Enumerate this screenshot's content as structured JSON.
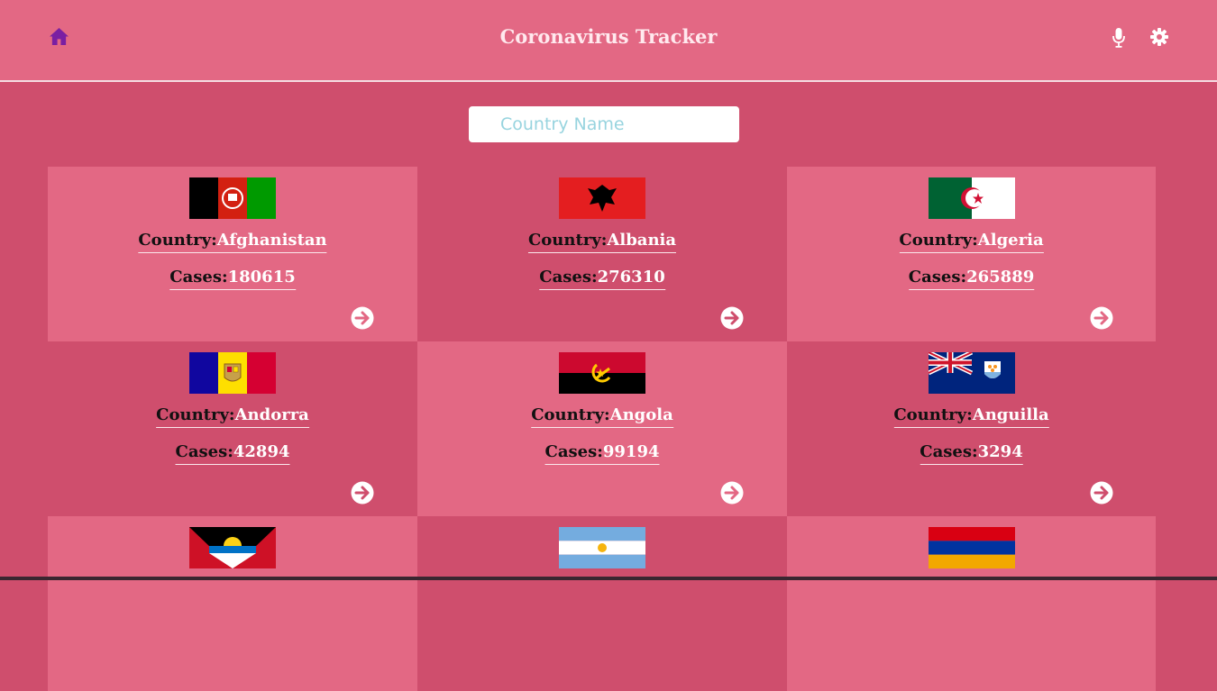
{
  "header": {
    "title": "Coronavirus Tracker",
    "home_icon": "home-icon",
    "mic_icon": "microphone-icon",
    "settings_icon": "gear-icon"
  },
  "search": {
    "placeholder": "Country Name",
    "value": ""
  },
  "labels": {
    "country": "Country:",
    "cases": "Cases:"
  },
  "colors": {
    "header_bg": "#e36884",
    "page_bg": "#cf4e6d",
    "card_light": "#e36884",
    "card_dark": "#cf4e6d",
    "home_icon": "#7a1fa2"
  },
  "countries": [
    {
      "name": "Afghanistan",
      "cases": "180615",
      "flag": "afghanistan-flag"
    },
    {
      "name": "Albania",
      "cases": "276310",
      "flag": "albania-flag"
    },
    {
      "name": "Algeria",
      "cases": "265889",
      "flag": "algeria-flag"
    },
    {
      "name": "Andorra",
      "cases": "42894",
      "flag": "andorra-flag"
    },
    {
      "name": "Angola",
      "cases": "99194",
      "flag": "angola-flag"
    },
    {
      "name": "Anguilla",
      "cases": "3294",
      "flag": "anguilla-flag"
    }
  ],
  "partial_row_flags": [
    "antigua-and-barbuda-flag",
    "argentina-flag",
    "armenia-flag"
  ]
}
